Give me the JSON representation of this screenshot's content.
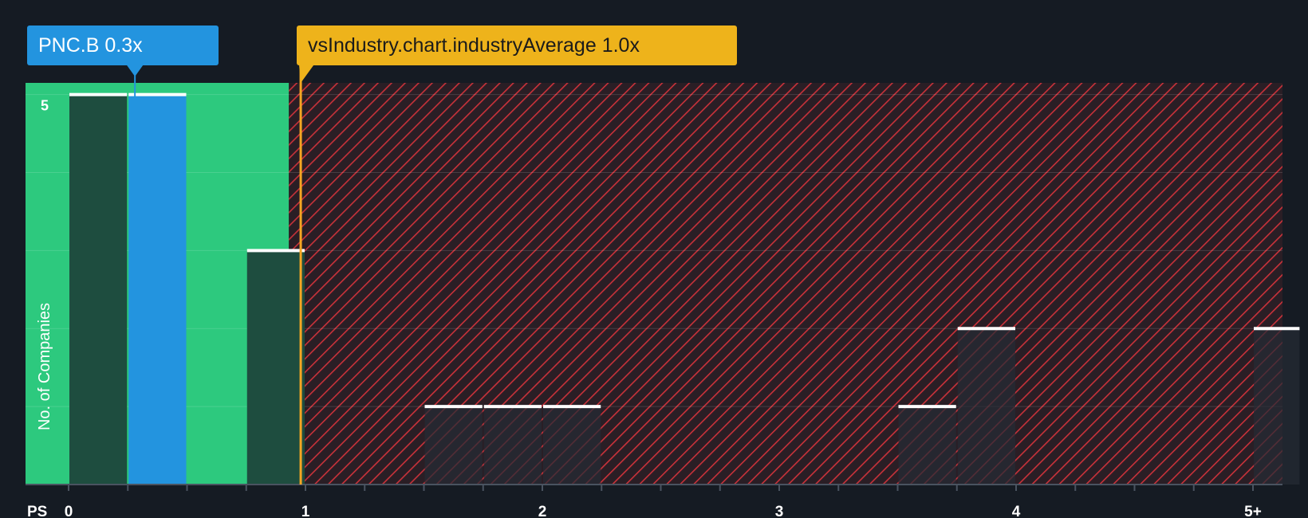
{
  "chart_data": {
    "type": "bar",
    "xlabel": "PS",
    "ylabel": "No. of Companies",
    "x_range": [
      0,
      5.2
    ],
    "ylim": [
      0,
      5.15
    ],
    "x_ticks": [
      {
        "value": 0,
        "label": "0"
      },
      {
        "value": 1,
        "label": "1"
      },
      {
        "value": 2,
        "label": "2"
      },
      {
        "value": 3,
        "label": "3"
      },
      {
        "value": 4,
        "label": "4"
      },
      {
        "value": 5,
        "label": "5+"
      }
    ],
    "y_ticks": [
      {
        "value": 5,
        "label": "5"
      }
    ],
    "bins": [
      {
        "start": 0.0,
        "end": 0.25,
        "count": 5,
        "highlight": false
      },
      {
        "start": 0.25,
        "end": 0.5,
        "count": 5,
        "highlight": true
      },
      {
        "start": 0.75,
        "end": 1.0,
        "count": 3,
        "highlight": false
      },
      {
        "start": 1.5,
        "end": 1.75,
        "count": 1,
        "highlight": false
      },
      {
        "start": 1.75,
        "end": 2.0,
        "count": 1,
        "highlight": false
      },
      {
        "start": 2.0,
        "end": 2.25,
        "count": 1,
        "highlight": false
      },
      {
        "start": 3.5,
        "end": 3.75,
        "count": 1,
        "highlight": false
      },
      {
        "start": 3.75,
        "end": 4.0,
        "count": 2,
        "highlight": false
      },
      {
        "start": 5.0,
        "end": 5.2,
        "count": 2,
        "highlight": false
      }
    ],
    "company": {
      "label": "PNC.B 0.3x",
      "value": 0.28
    },
    "industry_average": {
      "label": "vsIndustry.chart.industryAverage 1.0x",
      "value": 0.98
    },
    "fair_zone_end": 0.93
  },
  "colors": {
    "background": "#151b23",
    "fair_zone": "#2dc97e",
    "hatch_line": "#c9323a",
    "bar_in_zone": "#1e4d3f",
    "bar_hatched": "#252b35",
    "bar_highlight": "#2394df",
    "bar_top": "#ffffff",
    "company_callout": "#2394df",
    "industry_callout": "#eeb31b",
    "industry_line": "#f5a623",
    "axis": "#4a5360",
    "tick_text": "#ffffff"
  }
}
